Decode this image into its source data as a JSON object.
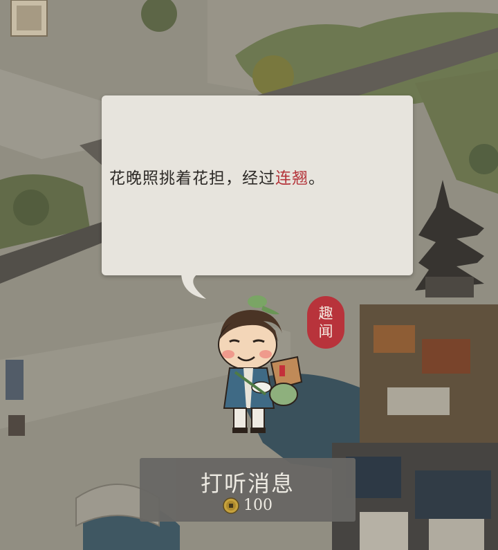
{
  "dialog": {
    "text_prefix": "花晚照挑着花担，经过",
    "text_highlight": "连翘",
    "text_suffix": "。"
  },
  "badge": {
    "line1": "趣",
    "line2": "闻"
  },
  "action_button": {
    "label": "打听消息",
    "cost": "100",
    "cost_icon": "copper-coin-icon"
  },
  "colors": {
    "highlight": "#b4343a",
    "badge": "#b8333b",
    "bubble": "#e7e4dd",
    "button": "#686764"
  }
}
